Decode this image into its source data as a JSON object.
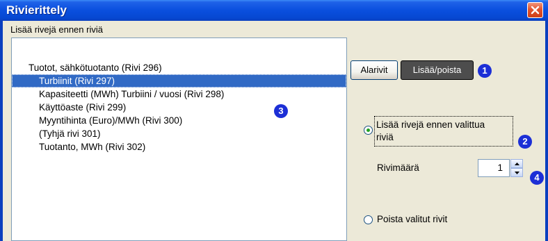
{
  "window": {
    "title": "Rivierittely"
  },
  "panel": {
    "label": "Lisää rivejä ennen riviä"
  },
  "list": {
    "items": [
      "Tuotot, sähkötuotanto (Rivi 296)",
      "Turbiinit (Rivi 297)",
      "Kapasiteetti (MWh) Turbiini / vuosi (Rivi 298)",
      "Käyttöaste (Rivi 299)",
      "Myyntihinta (Euro)/MWh (Rivi 300)",
      "(Tyhjä rivi 301)",
      "Tuotanto, MWh (Rivi 302)"
    ],
    "selected_index": 1
  },
  "tabs": {
    "alarivit": "Alarivit",
    "lisaa_poista": "Lisää/poista",
    "active": "Lisää/poista"
  },
  "options": {
    "insert_before_line1": "Lisää rivejä ennen valittua",
    "insert_before_line2": "riviä",
    "insert_selected": true,
    "row_count_label": "Rivimäärä",
    "row_count_value": "1",
    "delete_label": "Poista valitut rivit",
    "delete_selected": false
  },
  "badges": {
    "b1": "1",
    "b2": "2",
    "b3": "3",
    "b4": "4"
  },
  "colors": {
    "title_bar": "#0a4fde",
    "dialog_bg": "#ece9d8",
    "selection": "#316ac5",
    "badge": "#1c2fd6",
    "close_button": "#e2532e"
  },
  "icons": {
    "close": "close-icon",
    "spin_up": "spin-up-icon",
    "spin_down": "spin-down-icon"
  }
}
